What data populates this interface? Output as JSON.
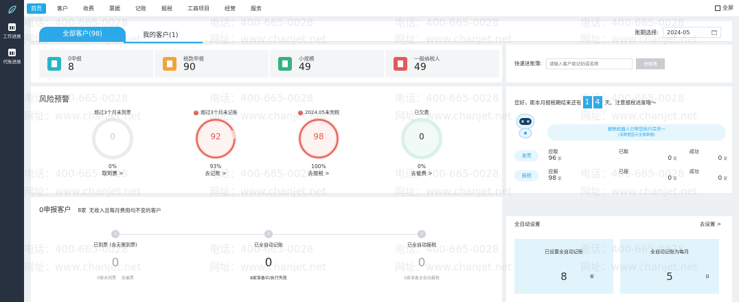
{
  "sidebar": {
    "items": [
      {
        "label": "工作进展"
      },
      {
        "label": "代账进展"
      }
    ]
  },
  "topnav": {
    "items": [
      {
        "label": "首页"
      },
      {
        "label": "客户"
      },
      {
        "label": "收费"
      },
      {
        "label": "票据"
      },
      {
        "label": "记账"
      },
      {
        "label": "报税"
      },
      {
        "label": "工商项目"
      },
      {
        "label": "经营"
      },
      {
        "label": "服务"
      }
    ],
    "fullscreen_label": "全屏",
    "accent": "#1fa7e6"
  },
  "tabs": {
    "all": "全部客户(98)",
    "mine": "我的客户(1)"
  },
  "period": {
    "label": "账期选择:",
    "value": "2024-05"
  },
  "stats": [
    {
      "label": "0申报",
      "value": "8",
      "color": "#2bb5c4"
    },
    {
      "label": "税款申报",
      "value": "90",
      "color": "#f2a43a"
    },
    {
      "label": "小规模",
      "value": "49",
      "color": "#35b37e"
    },
    {
      "label": "一般纳税人",
      "value": "49",
      "color": "#e45b5b"
    }
  ],
  "quick": {
    "label": "快速进账簿:",
    "placeholder": "请输入客户助记码或名称",
    "button": "进账簿"
  },
  "risk": {
    "title": "风险预警",
    "gauges": [
      {
        "caption": "超过3个月未到票",
        "value": "0",
        "pct": "0%",
        "link": "取到票 >",
        "alert": false
      },
      {
        "caption": "超过3个月未记账",
        "value": "92",
        "pct": "93%",
        "link": "去记账 >",
        "alert": true
      },
      {
        "caption": "2024.05未完税",
        "value": "98",
        "pct": "100%",
        "link": "去报税 >",
        "alert": true
      },
      {
        "caption": "已欠费",
        "value": "0",
        "pct": "0%",
        "link": "去催费 >",
        "alert": false
      }
    ]
  },
  "robot": {
    "msg_before": "您好，距本月报税期结束还有",
    "days": [
      "1",
      "4"
    ],
    "msg_after": "天。注意报税进度哦～",
    "bubble": "报税机器人已帮您执行完毕～",
    "bubble_sub": "(该数据显示全局数据)",
    "rows": [
      {
        "tag": "发票",
        "c1_label": "应取",
        "c1_value": "96",
        "c2_label": "已取",
        "c2_value": "0",
        "c3_label": "成功",
        "c3_value": "0"
      },
      {
        "tag": "报税",
        "c1_label": "应报",
        "c1_value": "98",
        "c2_label": "已报",
        "c2_value": "0",
        "c3_label": "成功",
        "c3_value": "0"
      }
    ],
    "unit": "家"
  },
  "zero": {
    "title": "0申报客户",
    "count": "8家",
    "desc": "无收入且每月费用均不变的客户",
    "steps": [
      {
        "num": "1",
        "label": "已到票 (含无需到票)",
        "value": "0",
        "foot1": "0家未到票",
        "foot2": "去催票"
      },
      {
        "num": "2",
        "label": "已全自动记账",
        "value": "0",
        "foot1": "8家准备中/执行失败",
        "foot2": ""
      },
      {
        "num": "3",
        "label": "已全自动报税",
        "value": "0",
        "foot1": "0家准备全自动报税",
        "foot2": ""
      }
    ]
  },
  "auto": {
    "title": "全自动设置",
    "link": "去设置 >",
    "boxes": [
      {
        "label": "已设置全自动记账",
        "value": "8",
        "unit": "家"
      },
      {
        "label": "全自动记账为每月",
        "value": "5",
        "unit": "日"
      }
    ]
  },
  "watermark": {
    "phone": "电话：400-665-0028",
    "site": "网址：www.chanjet.net"
  }
}
